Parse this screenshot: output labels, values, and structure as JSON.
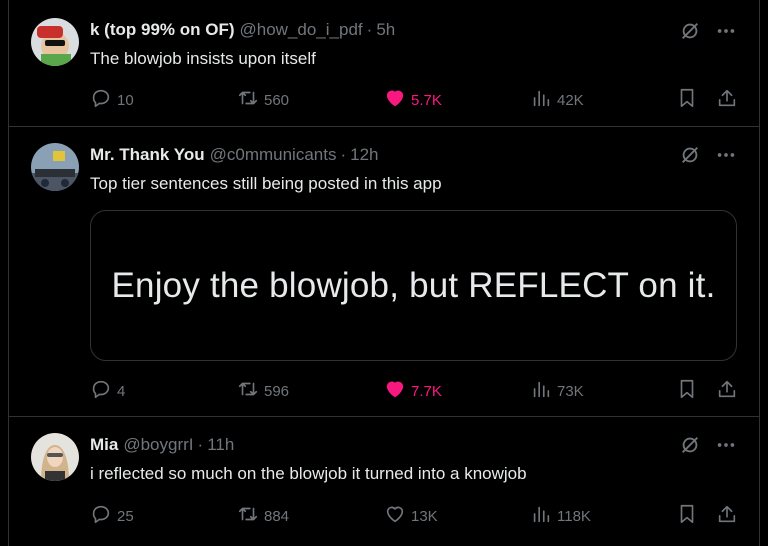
{
  "tweets": [
    {
      "name": "k (top 99% on OF)",
      "handle": "@how_do_i_pdf",
      "separator": "·",
      "time": "5h",
      "text": "The blowjob insists upon itself",
      "replies": "10",
      "reposts": "560",
      "likes": "5.7K",
      "liked": true,
      "views": "42K"
    },
    {
      "name": "Mr. Thank You",
      "handle": "@c0mmunicants",
      "separator": "·",
      "time": "12h",
      "text": "Top tier sentences still being posted in this app",
      "card_text": "Enjoy the blowjob, but REFLECT on it.",
      "replies": "4",
      "reposts": "596",
      "likes": "7.7K",
      "liked": true,
      "views": "73K"
    },
    {
      "name": "Mia",
      "handle": "@boygrrI",
      "separator": "·",
      "time": "11h",
      "text": "i reflected so much on the blowjob it turned into a knowjob",
      "replies": "25",
      "reposts": "884",
      "likes": "13K",
      "liked": false,
      "views": "118K"
    }
  ],
  "colors": {
    "background": "#000000",
    "text": "#e7e9ea",
    "muted": "#71767b",
    "like": "#f91880",
    "border": "#2f3336"
  }
}
